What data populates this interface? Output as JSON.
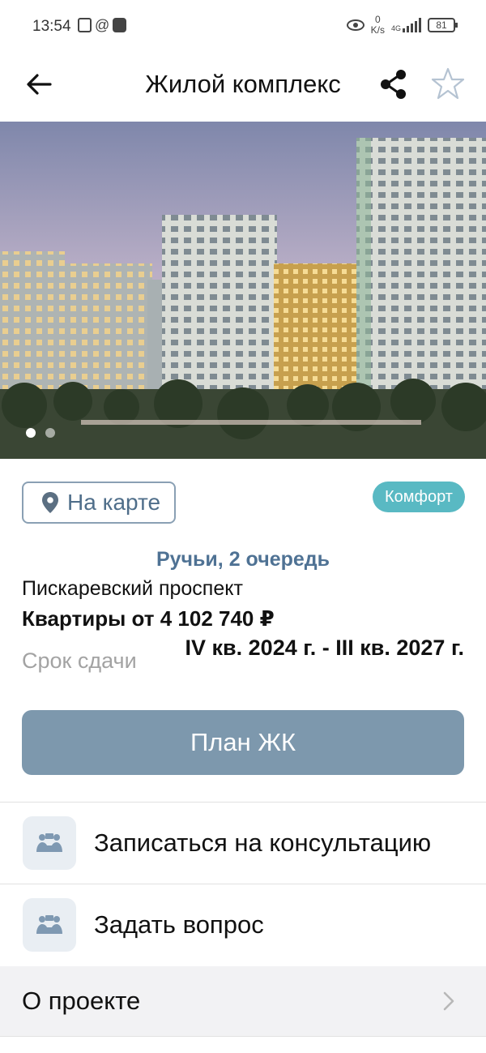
{
  "status": {
    "time": "13:54",
    "net_speed_value": "0",
    "net_speed_unit": "K/s",
    "network": "4G",
    "battery": "81"
  },
  "appbar": {
    "title": "Жилой комплекс"
  },
  "gallery": {
    "count": 2,
    "active_index": 0
  },
  "info": {
    "map_button_label": "На карте",
    "class_badge": "Комфорт",
    "complex_name": "Ручьи, 2 очередь",
    "address": "Пискаревский проспект",
    "price": "Квартиры от 4 102 740 ₽",
    "deadline_label": "Срок сдачи",
    "deadline_value": "IV кв. 2024 г. - III кв. 2027 г."
  },
  "plan_button_label": "План ЖК",
  "actions": [
    {
      "label": "Записаться на консультацию",
      "icon": "people-consult-icon"
    },
    {
      "label": "Задать вопрос",
      "icon": "people-question-icon"
    }
  ],
  "sections": {
    "about_label": "О проекте"
  },
  "colors": {
    "accent": "#7d98ad",
    "badge": "#59b9c3",
    "subtitle": "#4f7294"
  }
}
